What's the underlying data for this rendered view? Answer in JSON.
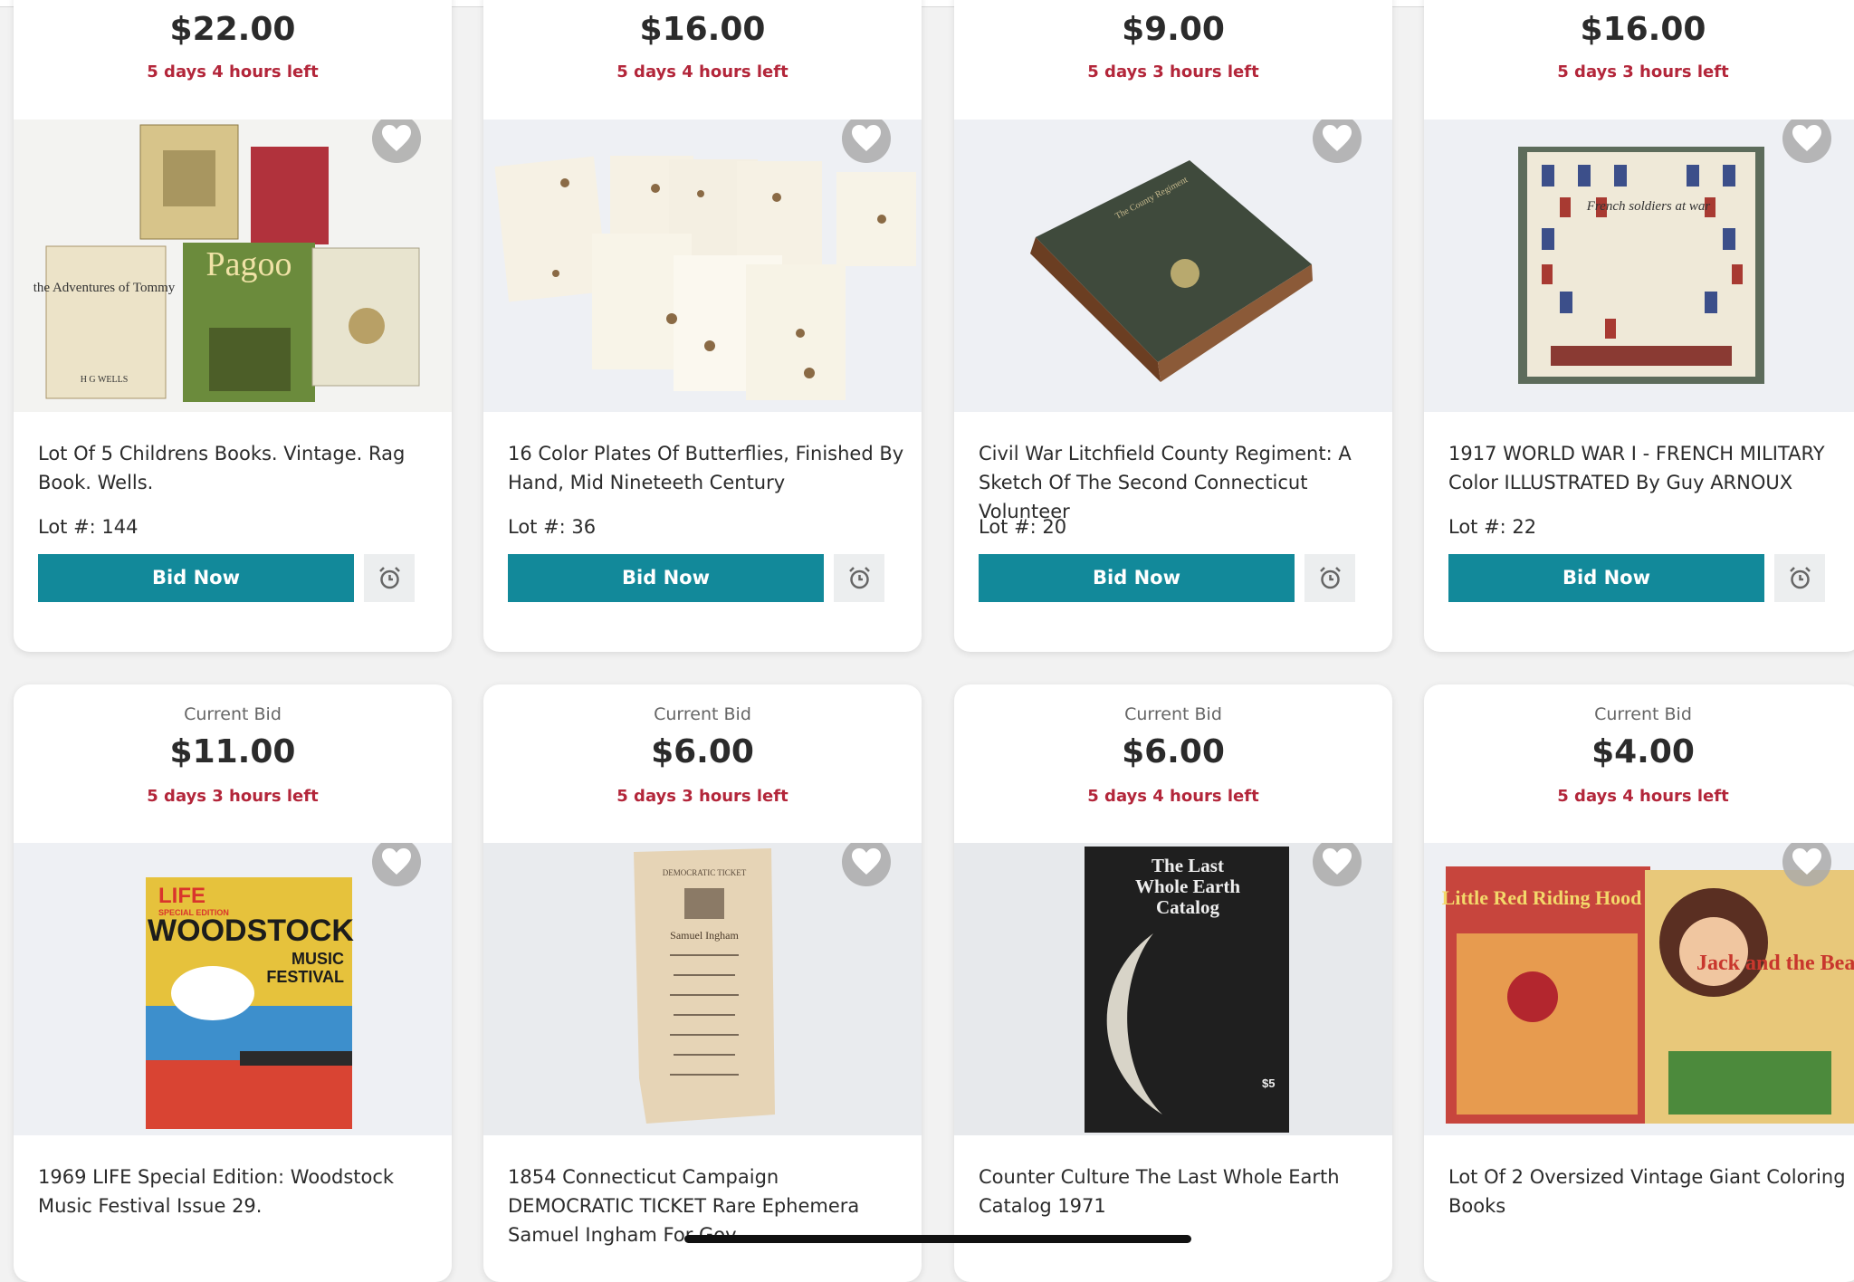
{
  "current_bid_label": "Current Bid",
  "bid_button_label": "Bid Now",
  "heart_icon": "heart-icon",
  "alarm_icon": "alarm-clock-icon",
  "accent_color": "#12899a",
  "time_color": "#b3263a",
  "lots": [
    {
      "price": "$22.00",
      "time_left": "5 days 4 hours left",
      "title": "Lot Of 5 Childrens Books. Vintage. Rag Book. Wells.",
      "lot": "Lot #: 144"
    },
    {
      "price": "$16.00",
      "time_left": "5 days 4 hours left",
      "title": "16 Color Plates Of Butterflies, Finished By Hand, Mid Nineteeth Century",
      "lot": "Lot #: 36"
    },
    {
      "price": "$9.00",
      "time_left": "5 days 3 hours left",
      "title": "Civil War Litchfield County Regiment: A Sketch Of The Second Connecticut Volunteer",
      "lot": "Lot #: 20"
    },
    {
      "price": "$16.00",
      "time_left": "5 days 3 hours left",
      "title": "1917 WORLD WAR I - FRENCH MILITARY Color ILLUSTRATED By Guy ARNOUX",
      "lot": "Lot #: 22"
    },
    {
      "price": "$11.00",
      "time_left": "5 days 3 hours left",
      "title": "1969 LIFE Special Edition: Woodstock Music Festival Issue 29."
    },
    {
      "price": "$6.00",
      "time_left": "5 days 3 hours left",
      "title": "1854 Connecticut Campaign DEMOCRATIC TICKET Rare Ephemera Samuel Ingham For Gov."
    },
    {
      "price": "$6.00",
      "time_left": "5 days 4 hours left",
      "title": "Counter Culture The Last Whole Earth Catalog 1971"
    },
    {
      "price": "$4.00",
      "time_left": "5 days 4 hours left",
      "title": "Lot Of 2 Oversized Vintage Giant Coloring Books"
    }
  ],
  "image_text": {
    "book1": "the Adventures of Tommy",
    "book1_author": "H G WELLS",
    "book2": "Pagoo",
    "civil_war": "The County Regiment",
    "french": "French soldiers at war",
    "life": "LIFE",
    "life_special": "SPECIAL EDITION",
    "woodstock": "WOODSTOCK",
    "woodstock2": "MUSIC",
    "woodstock3": "FESTIVAL",
    "ticket_head": "DEMOCRATIC TICKET",
    "ticket_name": "Samuel Ingham",
    "whole_earth": "The Last",
    "whole_earth2": "Whole Earth",
    "whole_earth3": "Catalog",
    "whole_earth_price": "$5",
    "coloring1": "Little Red Riding Hood",
    "coloring2": "Jack and the Beanstalk"
  }
}
